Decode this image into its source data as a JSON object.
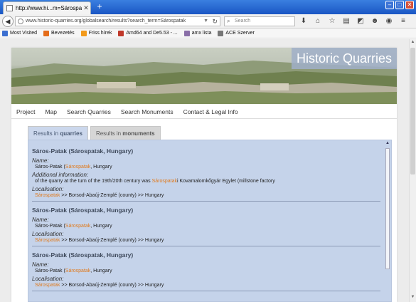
{
  "browser": {
    "tab_title": "http://www.hi...m=Sárospatak",
    "url": "www.historic-quarries.org/globalsearch/results?search_term=Sárospatak",
    "search_placeholder": "Search",
    "bookmarks": [
      {
        "label": "Most Visited",
        "icon": "star-icon",
        "color": "#3b6fd0"
      },
      {
        "label": "Bevezetés",
        "icon": "firefox-icon",
        "color": "#e46c1a"
      },
      {
        "label": "Friss hírek",
        "icon": "rss-icon",
        "color": "#f39a1a"
      },
      {
        "label": "Amd64 and De5.53 - ...",
        "icon": "flower-icon",
        "color": "#c0392b"
      },
      {
        "label": "amx lista",
        "icon": "page-icon",
        "color": "#8a6fa8"
      },
      {
        "label": "ACE Szerver",
        "icon": "page-icon",
        "color": "#777777"
      }
    ]
  },
  "site": {
    "brand": "Historic Quarries",
    "menu": [
      "Project",
      "Map",
      "Search Quarries",
      "Search Monuments",
      "Contact & Legal Info"
    ],
    "tabs": [
      {
        "prefix": "Results in ",
        "bold": "quarries",
        "active": true
      },
      {
        "prefix": "Results in ",
        "bold": "monuments",
        "active": false
      }
    ]
  },
  "results": [
    {
      "title": "Sáros-Patak (Sárospatak, Hungary)",
      "name_label": "Name:",
      "name_pre": "Sáros-Patak (",
      "name_link": "Sárospatak",
      "name_post": ", Hungary",
      "info_label": "Additional information:",
      "info_pre": "of the quarry at the turn of the 19th/20th century was ",
      "info_link": "Sárospatak",
      "info_post": "i Kovamalomkőgyár Egylet (millstone factory",
      "loc_label": "Localisation:",
      "loc_link": "Sárospatak",
      "loc_post": " >> Borsod-Abaúj-Zemplé (county) >> Hungary"
    },
    {
      "title": "Sáros-Patak (Sárospatak, Hungary)",
      "name_label": "Name:",
      "name_pre": "Sáros-Patak (",
      "name_link": "Sárospatak",
      "name_post": ", Hungary",
      "loc_label": "Localisation:",
      "loc_link": "Sárospatak",
      "loc_post": " >> Borsod-Abaúj-Zemplé (county) >> Hungary"
    },
    {
      "title": "Sáros-Patak (Sárospatak, Hungary)",
      "name_label": "Name:",
      "name_pre": "Sáros-Patak (",
      "name_link": "Sárospatak",
      "name_post": ", Hungary",
      "loc_label": "Localisation:",
      "loc_link": "Sárospatak",
      "loc_post": " >> Borsod-Abaúj-Zemplé (county) >> Hungary"
    }
  ]
}
